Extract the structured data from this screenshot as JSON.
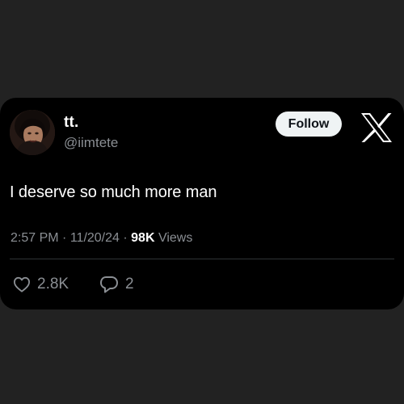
{
  "author": {
    "display_name": "tt.",
    "handle": "@iimtete"
  },
  "follow_button_label": "Follow",
  "tweet": {
    "text": "I deserve so much more man",
    "time": "2:57 PM",
    "date": "11/20/24",
    "separator": "·",
    "views_count": "98K",
    "views_label": "Views"
  },
  "actions": {
    "likes": "2.8K",
    "replies": "2"
  },
  "icons": {
    "logo": "x-logo-icon",
    "like": "heart-icon",
    "reply": "reply-bubble-icon"
  },
  "colors": {
    "background": "#222222",
    "card": "#000000",
    "text_primary": "#ffffff",
    "text_secondary": "#8b8f94",
    "button_bg": "#eff3f4",
    "button_text": "#0f1419"
  }
}
